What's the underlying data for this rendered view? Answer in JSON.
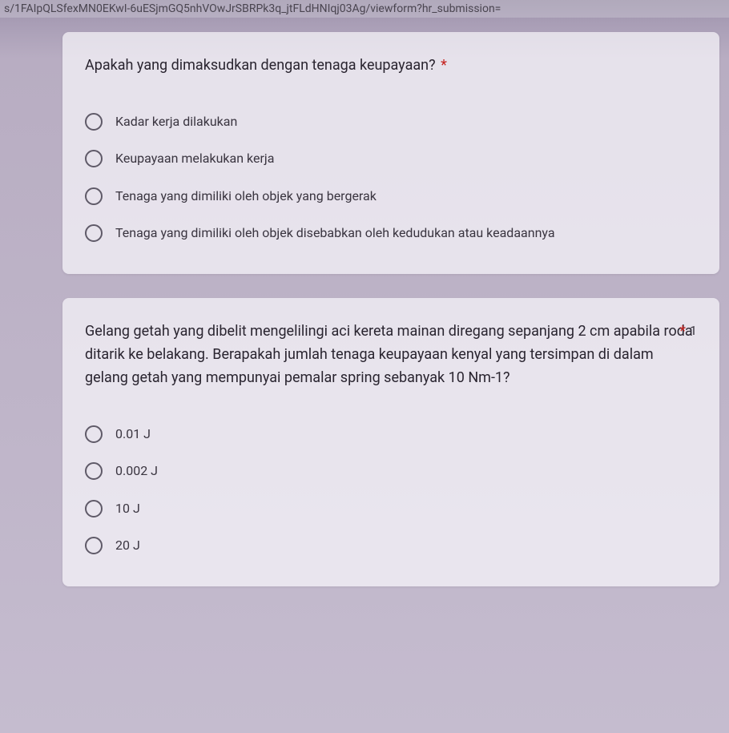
{
  "urlBar": "s/1FAIpQLSfexMN0EKwI-6uESjmGQ5nhVOwJrSBRPk3q_jtFLdHNIqj03Ag/viewform?hr_submission=",
  "questions": [
    {
      "title": "Apakah yang dimaksudkan dengan tenaga keupayaan?",
      "required": true,
      "points": "",
      "options": [
        "Kadar kerja dilakukan",
        "Keupayaan melakukan kerja",
        "Tenaga yang dimiliki oleh objek yang bergerak",
        "Tenaga yang dimiliki oleh objek disebabkan oleh kedudukan atau keadaannya"
      ]
    },
    {
      "title": "Gelang getah yang dibelit mengelilingi aci kereta mainan diregang sepanjang 2 cm apabila roda ditarik ke belakang. Berapakah jumlah tenaga keupayaan kenyal yang tersimpan di dalam gelang getah yang mempunyai pemalar spring sebanyak 10 Nm-1?",
      "required": true,
      "points": "1",
      "options": [
        "0.01 J",
        "0.002 J",
        "10 J",
        "20 J"
      ]
    }
  ]
}
